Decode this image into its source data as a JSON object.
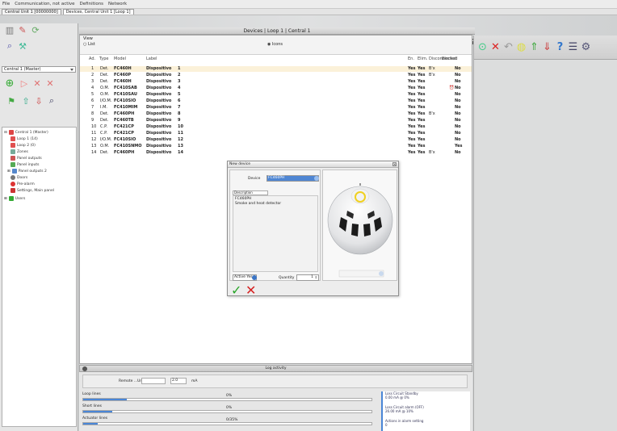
{
  "menubar": {
    "items": [
      "File",
      "Communication, not active",
      "Definitions",
      "Network"
    ]
  },
  "tabs": [
    "Central Unit 1 [00000000]",
    "Devices, Central Unit 1 [Loop 1]"
  ],
  "left_panel": {
    "central_selector": "Central 1 (Master)",
    "tree": [
      "Central 1 (Master)",
      "Loop 1 (14)",
      "Loop 2 (0)",
      "Zones",
      "Panel outputs",
      "Panel inputs",
      "Panel outputs 2",
      "Doors",
      "Pre-alarm",
      "Settings, Main panel",
      "Users"
    ]
  },
  "header": {
    "title": "Devices | Loop 1 | Central 1"
  },
  "view": {
    "label": "View",
    "option_list": "List",
    "option_icons": "Icons"
  },
  "columns": [
    "Ad.",
    "Type",
    "Model",
    "Label",
    "En.",
    "Elim.",
    "Disconnected",
    "Blocked"
  ],
  "devices": [
    {
      "addr": "1",
      "type": "Det.",
      "model": "FC460H",
      "label": "Dispositivo",
      "num": "1",
      "en": "Yes",
      "c2": "Yes",
      "c3": "B'x",
      "c4": "No"
    },
    {
      "addr": "2",
      "type": "Det.",
      "model": "FC460P",
      "label": "Dispositivo",
      "num": "2",
      "en": "Yes",
      "c2": "Yes",
      "c3": "B'x",
      "c4": "No"
    },
    {
      "addr": "3",
      "type": "Det.",
      "model": "FC460H",
      "label": "Dispositivo",
      "num": "3",
      "en": "Yes",
      "c2": "Yes",
      "c3": "",
      "c4": "No"
    },
    {
      "addr": "4",
      "type": "O.M.",
      "model": "FC410SAB",
      "label": "Dispositivo",
      "num": "4",
      "en": "Yes",
      "c2": "Yes",
      "c3": "",
      "c4": "No"
    },
    {
      "addr": "5",
      "type": "O.M.",
      "model": "FC410SAU",
      "label": "Dispositivo",
      "num": "5",
      "en": "Yes",
      "c2": "Yes",
      "c3": "",
      "c4": "No"
    },
    {
      "addr": "6",
      "type": "I/O.M.",
      "model": "FC410SIO",
      "label": "Dispositivo",
      "num": "6",
      "en": "Yes",
      "c2": "Yes",
      "c3": "",
      "c4": "No"
    },
    {
      "addr": "7",
      "type": "I.M.",
      "model": "FC410MIM",
      "label": "Dispositivo",
      "num": "7",
      "en": "Yes",
      "c2": "Yes",
      "c3": "",
      "c4": "No"
    },
    {
      "addr": "8",
      "type": "Det.",
      "model": "FC460PH",
      "label": "Dispositivo",
      "num": "8",
      "en": "Yes",
      "c2": "Yes",
      "c3": "B'x",
      "c4": "No"
    },
    {
      "addr": "9",
      "type": "Det.",
      "model": "FC460TB",
      "label": "Dispositivo",
      "num": "9",
      "en": "Yes",
      "c2": "Yes",
      "c3": "",
      "c4": "No"
    },
    {
      "addr": "10",
      "type": "C.P.",
      "model": "FC421CP",
      "label": "Dispositivo",
      "num": "10",
      "en": "Yes",
      "c2": "Yes",
      "c3": "",
      "c4": "No"
    },
    {
      "addr": "11",
      "type": "C.P.",
      "model": "FC421CP",
      "label": "Dispositivo",
      "num": "11",
      "en": "Yes",
      "c2": "Yes",
      "c3": "",
      "c4": "No"
    },
    {
      "addr": "12",
      "type": "I/O.M.",
      "model": "FC410SIO",
      "label": "Dispositivo",
      "num": "12",
      "en": "Yes",
      "c2": "Yes",
      "c3": "",
      "c4": "No"
    },
    {
      "addr": "13",
      "type": "O.M.",
      "model": "FC410SNMO",
      "label": "Dispositivo",
      "num": "13",
      "en": "Yes",
      "c2": "Yes",
      "c3": "",
      "c4": "Yes"
    },
    {
      "addr": "14",
      "type": "Det.",
      "model": "FC460PH",
      "label": "Dispositivo",
      "num": "14",
      "en": "Yes",
      "c2": "Yes",
      "c3": "B'x",
      "c4": "No"
    }
  ],
  "dialog": {
    "title": "New device",
    "device_label": "Device",
    "device_value": "FC460PH",
    "description_label": "Description",
    "description_model": "FC460PH",
    "description_text": "Smoke and heat detector",
    "active_label": "Active Yes",
    "quantity_label": "Quantity",
    "quantity_value": "1",
    "ok_symbol": "✓",
    "cancel_symbol": "✕"
  },
  "log": {
    "title": "Log activity",
    "remote_label": "Remote ...Units",
    "remote_value": "2.0",
    "remote_unit": "mA",
    "bars": [
      {
        "label": "Loop lines",
        "value_text": "0%",
        "fraction": 0.15
      },
      {
        "label": "Short lines",
        "value_text": "0%",
        "fraction": 0.1
      },
      {
        "label": "Actuator lines",
        "value_text": "0/35%",
        "fraction": 0.05
      }
    ],
    "status": [
      {
        "line1": "Loss Circuit Standby",
        "line2": "0.00 mA @ 0%"
      },
      {
        "line1": "Loss Circuit alarm (OFF)",
        "line2": "26.00 mA @ 10%"
      },
      {
        "line1": "Actions in alarm setting",
        "line2": "0"
      }
    ]
  },
  "colors": {
    "accent": "#3b75c6",
    "ok": "#2aa62a",
    "cancel": "#d62222",
    "sensor_ring": "#f0d020"
  }
}
